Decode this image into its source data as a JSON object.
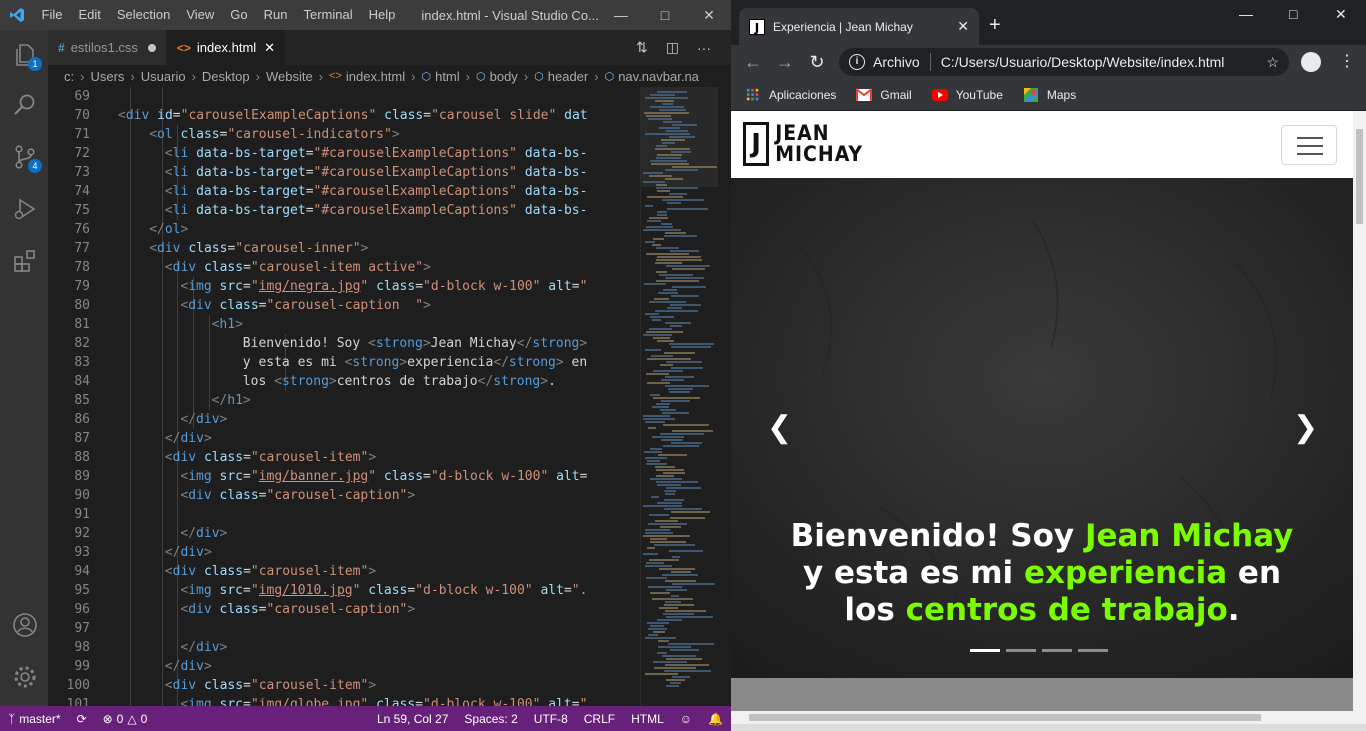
{
  "vscode": {
    "menu": [
      "File",
      "Edit",
      "Selection",
      "View",
      "Go",
      "Run",
      "Terminal",
      "Help"
    ],
    "window_title": "index.html - Visual Studio Co...",
    "tabs": [
      {
        "icon": "#",
        "label": "estilos1.css",
        "modified": true
      },
      {
        "icon": "<>",
        "label": "index.html",
        "active": true
      }
    ],
    "breadcrumb": [
      "c:",
      "Users",
      "Usuario",
      "Desktop",
      "Website",
      "index.html",
      "html",
      "body",
      "header",
      "nav.navbar.na"
    ],
    "badges": {
      "explorer": "1",
      "scm": "4"
    },
    "line_numbers": [
      "69",
      "70",
      "71",
      "72",
      "73",
      "74",
      "75",
      "76",
      "77",
      "78",
      "79",
      "80",
      "81",
      "82",
      "83",
      "84",
      "85",
      "86",
      "87",
      "88",
      "89",
      "90",
      "91",
      "92",
      "93",
      "94",
      "95",
      "96",
      "97",
      "98",
      "99",
      "100",
      "101"
    ],
    "status": {
      "branch": "master*",
      "problems_errors": "0",
      "problems_warnings": "0",
      "position": "Ln 59, Col 27",
      "spaces": "Spaces: 2",
      "encoding": "UTF-8",
      "eol": "CRLF",
      "language": "HTML"
    }
  },
  "browser": {
    "tab_title": "Experiencia | Jean Michay",
    "favicon_letter": "J",
    "address_prefix": "Archivo",
    "address": "C:/Users/Usuario/Desktop/Website/index.html",
    "bookmarks": [
      {
        "icon": "apps-icon",
        "label": "Aplicaciones"
      },
      {
        "icon": "gmail-icon",
        "label": "Gmail"
      },
      {
        "icon": "youtube-icon",
        "label": "YouTube"
      },
      {
        "icon": "maps-icon",
        "label": "Maps"
      }
    ]
  },
  "website": {
    "brand_letter": "J",
    "brand_line1": "JEAN",
    "brand_line2": "MICHAY",
    "caption": {
      "part1": "Bienvenido! Soy ",
      "strong1": "Jean Michay",
      "part2": "y esta es mi ",
      "strong2": "experiencia",
      "part3": " en",
      "part4": "los ",
      "strong3": "centros de trabajo",
      "part5": "."
    },
    "indicator_count": 4,
    "active_indicator": 0,
    "accent": "#7cfc00"
  }
}
